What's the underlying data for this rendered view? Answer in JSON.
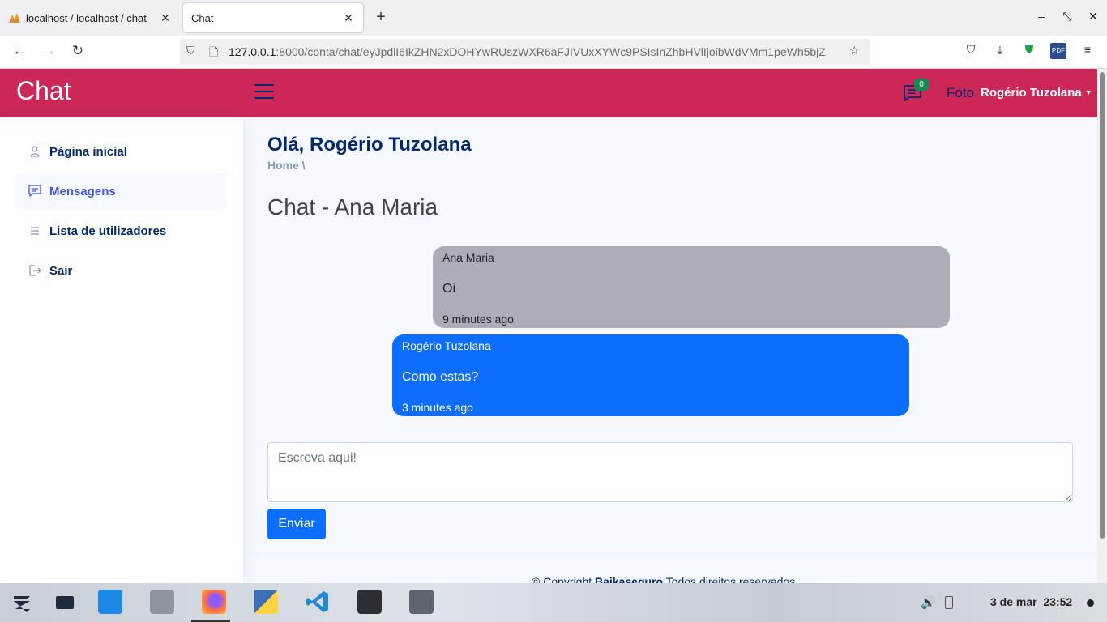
{
  "browser": {
    "tabs": [
      {
        "title": "localhost / localhost / chat",
        "active": false
      },
      {
        "title": "Chat",
        "active": true
      }
    ],
    "url_host": "127.0.0.1",
    "url_path": ":8000/conta/chat/eyJpdiI6IkZHN2xDOHYwRUszWXR6aFJIVUxXYWc9PSIsInZhbHVlIjoibWdVMm1peWh5bjZ"
  },
  "header": {
    "brand": "Chat",
    "notification_count": "0",
    "foto_label": "Foto",
    "user_name": "Rogério Tuzolana"
  },
  "sidebar": {
    "items": [
      {
        "label": "Página inicial",
        "icon": "person-icon",
        "active": false
      },
      {
        "label": "Mensagens",
        "icon": "message-icon",
        "active": true
      },
      {
        "label": "Lista de utilizadores",
        "icon": "list-icon",
        "active": false
      },
      {
        "label": "Sair",
        "icon": "logout-icon",
        "active": false
      }
    ]
  },
  "main": {
    "greeting": "Olá, Rogério Tuzolana",
    "breadcrumb": "Home \\",
    "chat_title": "Chat - Ana Maria",
    "messages": [
      {
        "sender": "Ana Maria",
        "text": "Oi",
        "time": "9 minutes ago"
      },
      {
        "sender": "Rogério Tuzolana",
        "text": "Como estas?",
        "time": "3 minutes ago"
      }
    ],
    "input_placeholder": "Escreva aqui!",
    "send_label": "Enviar"
  },
  "footer": {
    "prefix": "© Copyright ",
    "company": "Baikaseguro",
    "suffix": " Todos direitos reservados"
  },
  "taskbar": {
    "date": "3 de mar",
    "time": "23:52"
  },
  "colors": {
    "header_bg": "#cc2757",
    "navy": "#012970",
    "primary": "#0d6efd",
    "incoming_bubble": "#aeacb7"
  }
}
